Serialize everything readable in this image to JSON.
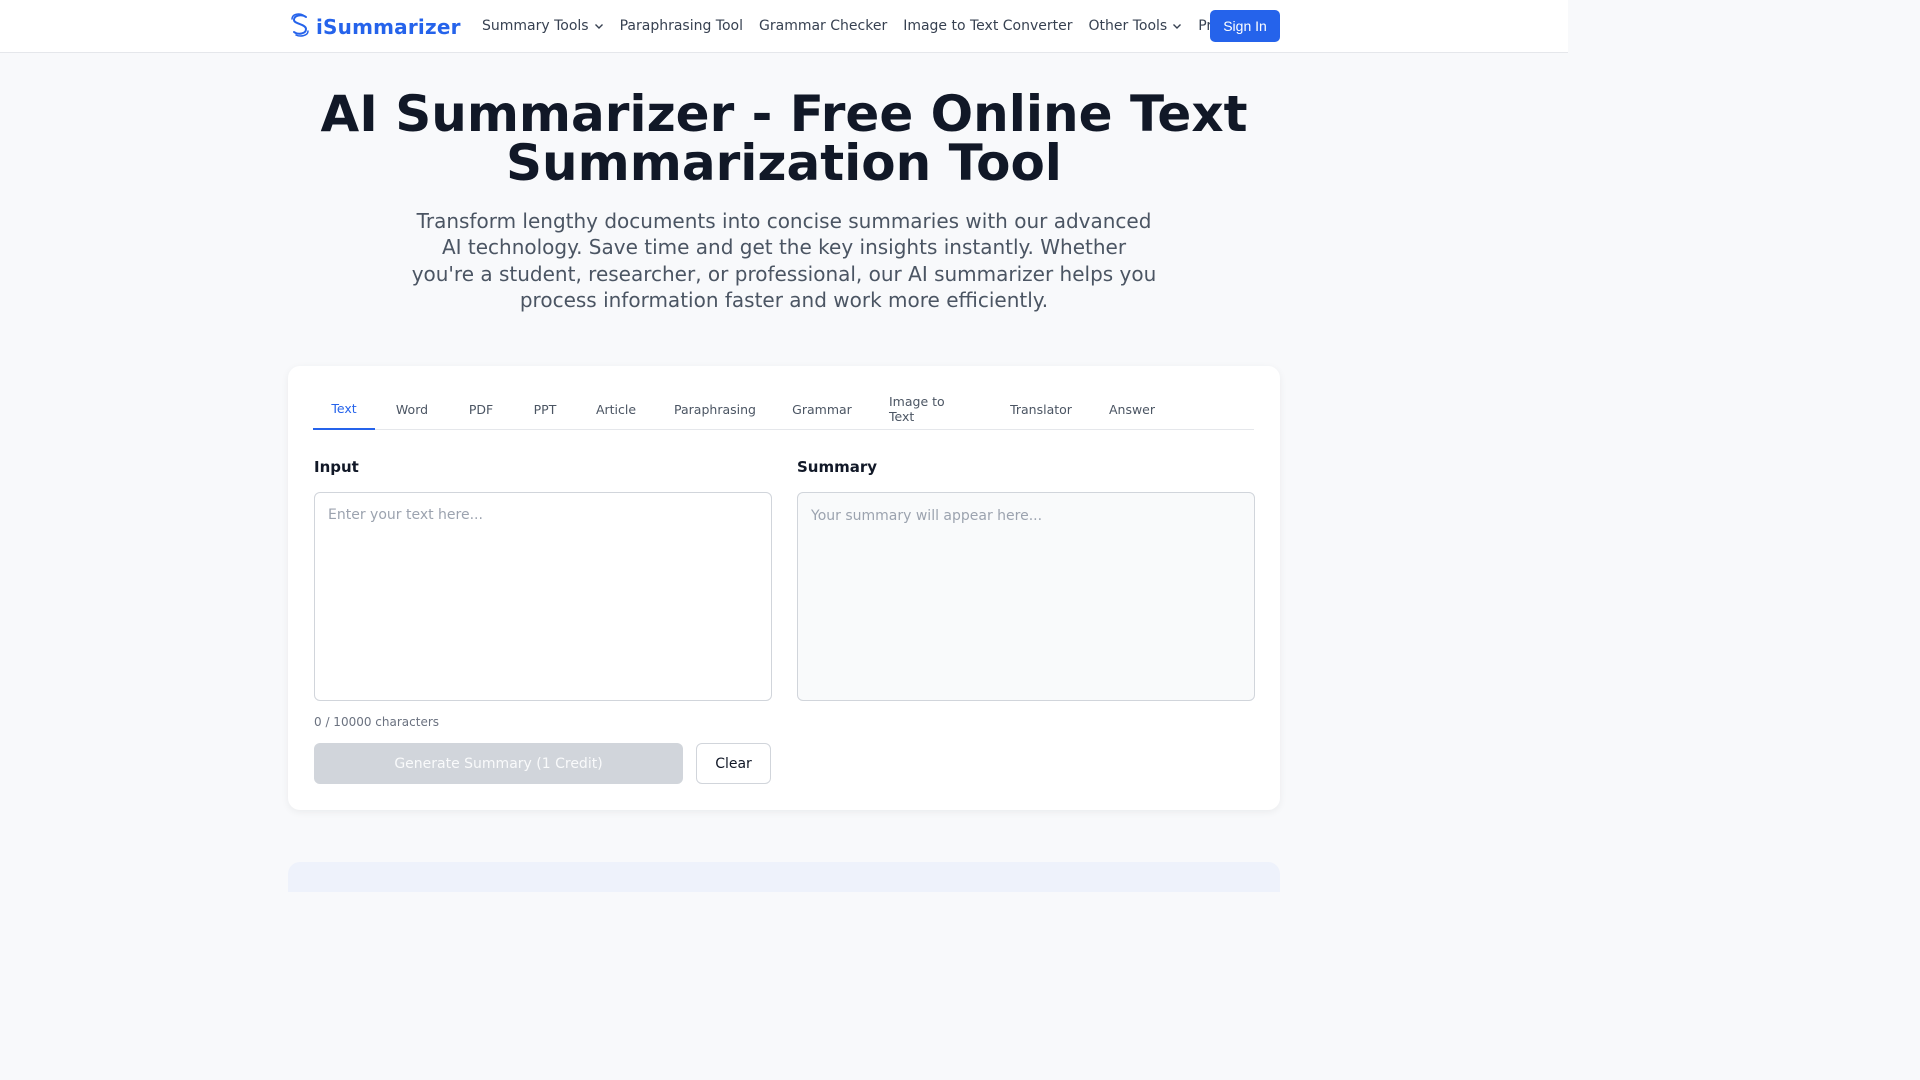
{
  "header": {
    "logo_text": "iSummarizer",
    "logo_icon": "s-swirl-logo-icon",
    "nav": [
      {
        "label": "Summary Tools",
        "dropdown": true
      },
      {
        "label": "Paraphrasing Tool",
        "dropdown": false
      },
      {
        "label": "Grammar Checker",
        "dropdown": false
      },
      {
        "label": "Image to Text Converter",
        "dropdown": false
      },
      {
        "label": "Other Tools",
        "dropdown": true
      },
      {
        "label": "Pricing",
        "dropdown": false
      }
    ],
    "signin_label": "Sign In"
  },
  "hero": {
    "title_line1": "AI Summarizer - Free Online Text",
    "title_line2": "Summarization Tool",
    "subtitle": "Transform lengthy documents into concise summaries with our advanced AI technology. Save time and get the key insights instantly. Whether you're a student, researcher, or professional, our AI summarizer helps you process information faster and work more efficiently."
  },
  "tool": {
    "tabs": [
      "Text",
      "Word",
      "PDF",
      "PPT",
      "Article",
      "Paraphrasing",
      "Grammar",
      "Image to Text",
      "Translator",
      "Answer"
    ],
    "active_tab": "Text",
    "input_label": "Input",
    "input_placeholder": "Enter your text here...",
    "input_value": "",
    "summary_label": "Summary",
    "summary_placeholder": "Your summary will appear here...",
    "char_count": "0 / 10000 characters",
    "generate_label": "Generate Summary (1 Credit)",
    "clear_label": "Clear"
  },
  "colors": {
    "brand": "#2563eb",
    "page_bg": "#f8f9fb",
    "disabled_button": "#d1d5db"
  }
}
